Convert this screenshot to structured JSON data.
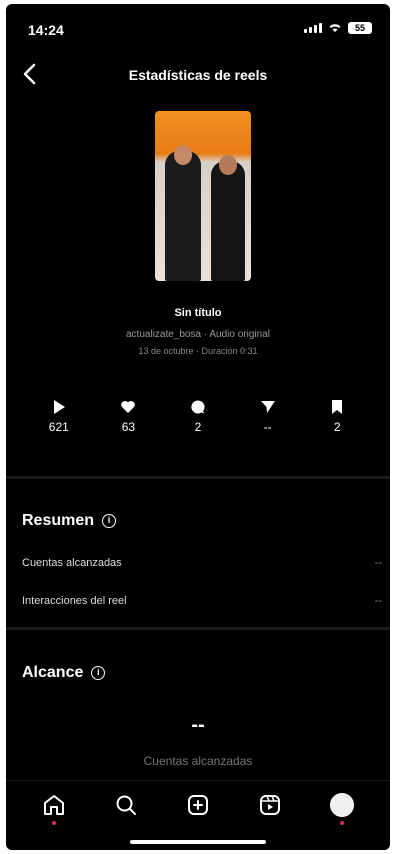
{
  "status": {
    "time": "14:24",
    "battery": "55"
  },
  "header": {
    "title": "Estadísticas de reels"
  },
  "reel": {
    "name": "Sin título",
    "audio": "actualizate_bosa · Audio original",
    "date": "13 de octubre · Duración 0:31"
  },
  "stats": [
    {
      "icon": "play-icon",
      "value": "621"
    },
    {
      "icon": "heart-icon",
      "value": "63"
    },
    {
      "icon": "comment-icon",
      "value": "2"
    },
    {
      "icon": "share-icon",
      "value": "--"
    },
    {
      "icon": "bookmark-icon",
      "value": "2"
    }
  ],
  "summary": {
    "title": "Resumen",
    "rows": [
      {
        "label": "Cuentas alcanzadas",
        "value": "--"
      },
      {
        "label": "Interacciones del reel",
        "value": "--"
      }
    ]
  },
  "reach": {
    "title": "Alcance",
    "value": "--",
    "label": "Cuentas alcanzadas"
  },
  "tabs": [
    "home",
    "search",
    "create",
    "reels",
    "profile"
  ]
}
